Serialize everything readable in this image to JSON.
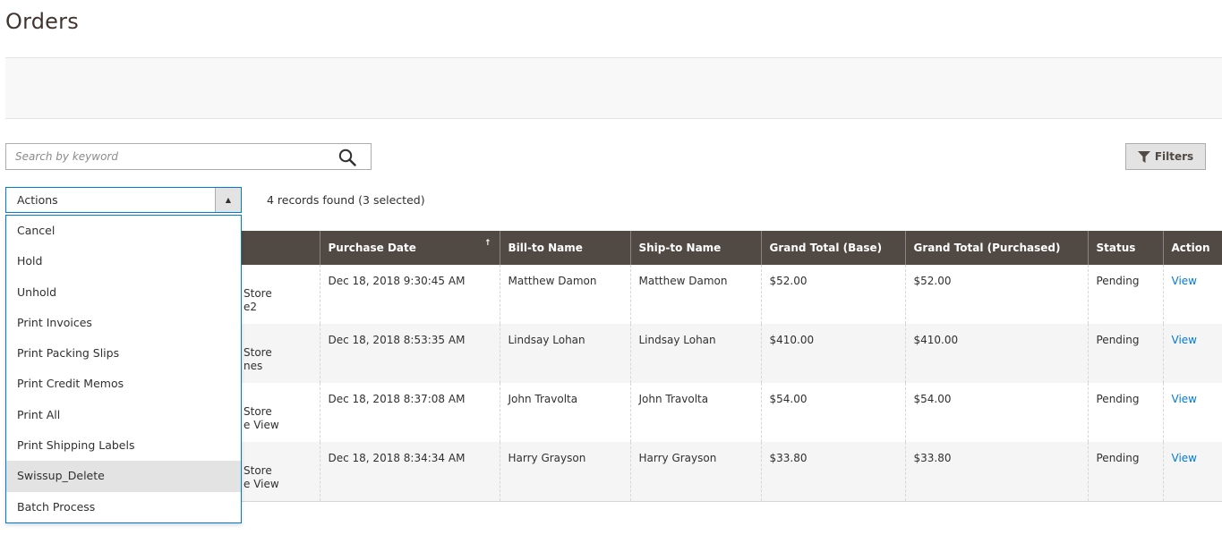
{
  "page": {
    "title": "Orders"
  },
  "search": {
    "placeholder": "Search by keyword"
  },
  "filters": {
    "label": "Filters"
  },
  "actions": {
    "label": "Actions",
    "items": [
      "Cancel",
      "Hold",
      "Unhold",
      "Print Invoices",
      "Print Packing Slips",
      "Print Credit Memos",
      "Print All",
      "Print Shipping Labels",
      "Swissup_Delete",
      "Batch Process"
    ],
    "hovered_item": "Swissup_Delete"
  },
  "records": {
    "text": "4 records found (3 selected)"
  },
  "grid": {
    "columns": [
      "Purchase Date",
      "Bill-to Name",
      "Ship-to Name",
      "Grand Total (Base)",
      "Grand Total (Purchased)",
      "Status",
      "Action"
    ],
    "sort_indicator": "↑",
    "rows": [
      {
        "store_line1": "Store",
        "store_line2": "e2",
        "purchase_date": "Dec 18, 2018 9:30:45 AM",
        "bill_to": "Matthew Damon",
        "ship_to": "Matthew Damon",
        "grand_total_base": "$52.00",
        "grand_total_purchased": "$52.00",
        "status": "Pending",
        "action": "View"
      },
      {
        "store_line1": "Store",
        "store_line2": "nes",
        "purchase_date": "Dec 18, 2018 8:53:35 AM",
        "bill_to": "Lindsay Lohan",
        "ship_to": "Lindsay Lohan",
        "grand_total_base": "$410.00",
        "grand_total_purchased": "$410.00",
        "status": "Pending",
        "action": "View"
      },
      {
        "store_line1": "Store",
        "store_line2": "e View",
        "purchase_date": "Dec 18, 2018 8:37:08 AM",
        "bill_to": "John Travolta",
        "ship_to": "John Travolta",
        "grand_total_base": "$54.00",
        "grand_total_purchased": "$54.00",
        "status": "Pending",
        "action": "View"
      },
      {
        "store_line1": "Store",
        "store_line2": "e View",
        "purchase_date": "Dec 18, 2018 8:34:34 AM",
        "bill_to": "Harry Grayson",
        "ship_to": "Harry Grayson",
        "grand_total_base": "$33.80",
        "grand_total_purchased": "$33.80",
        "status": "Pending",
        "action": "View"
      }
    ]
  },
  "colors": {
    "header_bg": "#514943",
    "accent": "#007bdb",
    "link": "#007bdb",
    "button_bg": "#e3e3e3"
  },
  "icons": {
    "search": "search-icon",
    "filter": "filter-icon",
    "dropdown": "caret-up-icon"
  }
}
